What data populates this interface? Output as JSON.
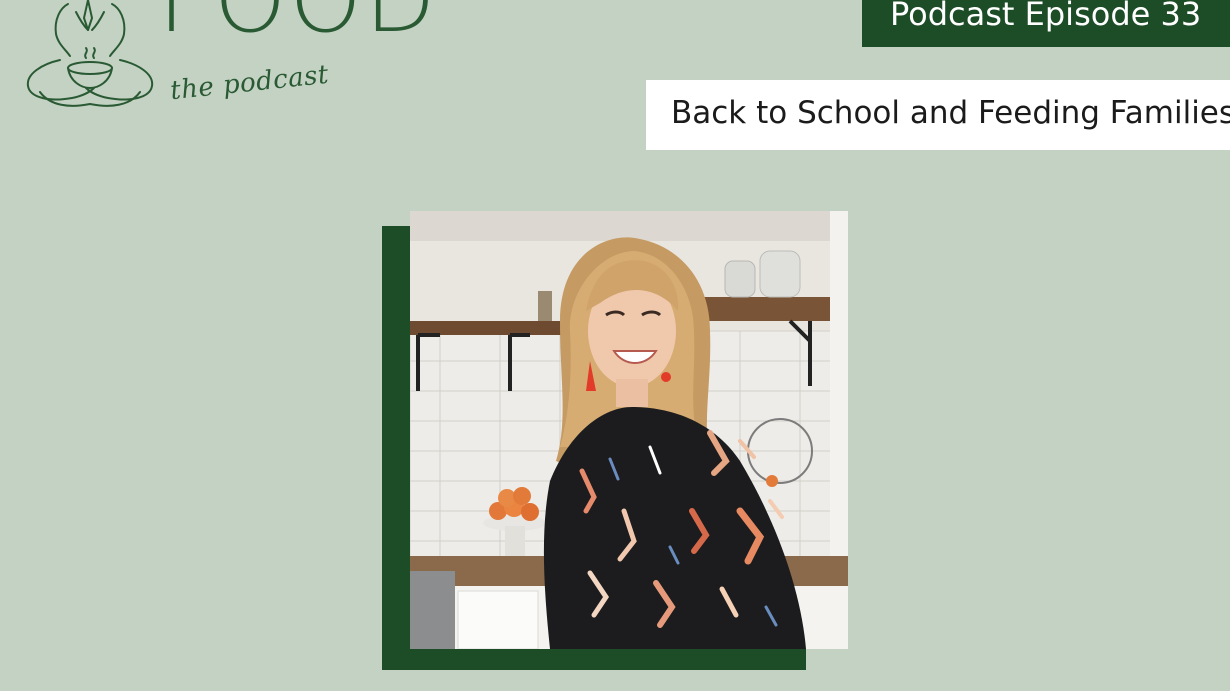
{
  "logo": {
    "wordmark": "FOOD",
    "subtitle": "the podcast",
    "icon": "meditating-figure-with-bowl-icon"
  },
  "episode": {
    "label": "Podcast Episode 33"
  },
  "episode_title": "Back to School and Feeding Families",
  "photo": {
    "subject": "host-portrait"
  },
  "colors": {
    "background": "#c3d2c3",
    "brand_green": "#1d4d27",
    "logo_green": "#2a5a33",
    "banner_white": "#ffffff"
  }
}
